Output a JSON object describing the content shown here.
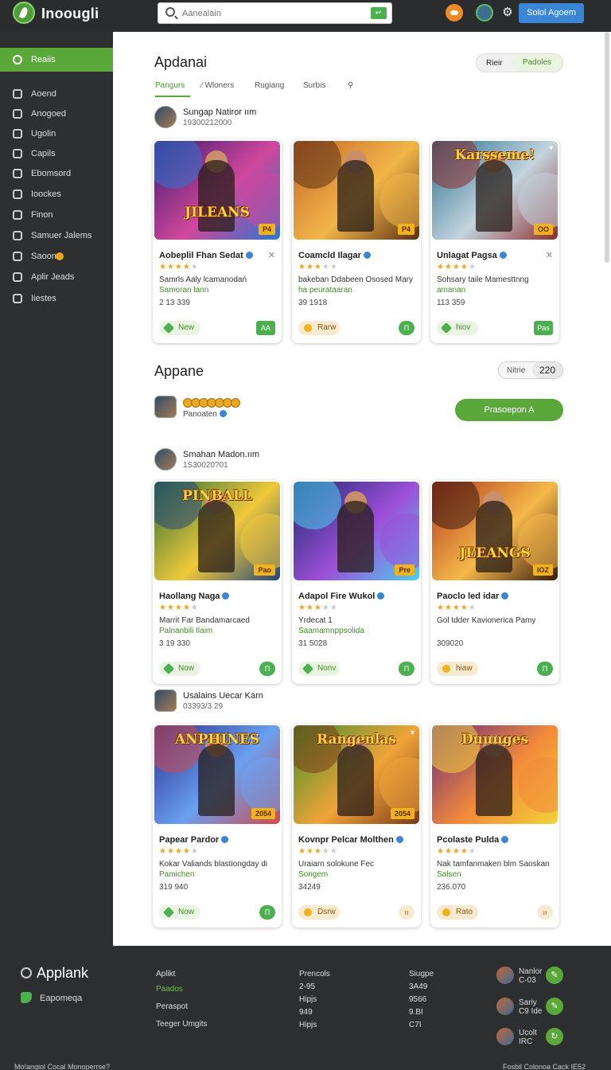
{
  "header": {
    "brand": "Inoougli",
    "search_placeholder": "Aanealain",
    "search_button": "↵",
    "signin_label": "Solol Agoem"
  },
  "sidebar": {
    "items": [
      {
        "label": "Reaiis",
        "icon": "user-icon",
        "active": true
      },
      {
        "label": "Aoend",
        "icon": "phone-icon"
      },
      {
        "label": "Anogoed",
        "icon": "grid-icon"
      },
      {
        "label": "Ugolin",
        "icon": "person-icon"
      },
      {
        "label": "Capils",
        "icon": "lock-icon"
      },
      {
        "label": "Ebomsord",
        "icon": "board-icon"
      },
      {
        "label": "Ioockes",
        "icon": "blocks-icon"
      },
      {
        "label": "Finon",
        "icon": "chart-icon"
      },
      {
        "label": "Samuer Jalems",
        "icon": "list-icon"
      },
      {
        "label": "Saoon",
        "icon": "people-icon"
      },
      {
        "label": "Aplir Jeads",
        "icon": "info-icon"
      },
      {
        "label": "Iiestes",
        "icon": "gear-icon"
      }
    ]
  },
  "section1": {
    "title": "Apdanai",
    "toggle": {
      "left": "Rieir",
      "right": "Padoles"
    },
    "tabs": [
      "Pangurs",
      "⁄ Wloners",
      "Rugiang",
      "Surbis",
      "⚲"
    ]
  },
  "section2": {
    "title": "Appane",
    "counter_label": "Nitrie",
    "counter_value": "220",
    "user_line": "Panoaten",
    "button": "Prasoepon A"
  },
  "groups": [
    {
      "user": {
        "name": "Sungap Natiror ıım",
        "date": "19300212000"
      },
      "cards": [
        {
          "art_title": "JILEANS",
          "art_badge": "P4",
          "title": "Aobeplil Fhan Sedat",
          "rating": 4,
          "desc": "Samrls Aaly lcamanodań",
          "desc_green": "Samoran lann",
          "num": "2 13 339",
          "pill": "New",
          "pill_style": "green",
          "action": "AA",
          "closable": true
        },
        {
          "art_title": "",
          "art_badge": "P4",
          "title": "Coamcld Ilagar",
          "rating": 3,
          "desc": "bakeban Ddabeen Ososed Mary",
          "desc_green": "ha peurataaran",
          "num": "39 1918",
          "pill": "Rarw",
          "pill_style": "gold",
          "action": "Π",
          "closable": false
        },
        {
          "art_title": "Karsseme!",
          "art_badge": "OO",
          "title": "Unlagat Pagsa",
          "rating": 4,
          "desc": "Sohsary taile Mamesttnng",
          "desc_green": "amanan",
          "num": "113 359",
          "pill": "hiov",
          "pill_style": "green",
          "action": "Pas",
          "closable": true
        }
      ]
    },
    {
      "user": {
        "name": "Smahan Madon.ıım",
        "date": "1S30020?01"
      },
      "cards": [
        {
          "art_title": "PINBALL",
          "art_badge": "Pao",
          "title": "Haollang Naga",
          "rating": 4,
          "desc": "Marrit Far Bandamarcaed",
          "desc_green": "Palnanbili Ilaim",
          "num": "3 19 330",
          "pill": "Now",
          "pill_style": "green",
          "action": "Π",
          "closable": false
        },
        {
          "art_title": "",
          "art_badge": "Pre",
          "title": "Adapol Fire Wukol",
          "rating": 3,
          "desc": "Yrdecat 1",
          "desc_green": "Saamamnppsolida",
          "num": "31 5028",
          "pill": "Nonv",
          "pill_style": "green",
          "action": "Π",
          "closable": false
        },
        {
          "art_title": "JEEANGS",
          "art_badge": "IOZ",
          "title": "Paoclo led idar",
          "rating": 4,
          "desc": "Gol tdder Kavionericа Pamy",
          "desc_green": "",
          "num": "309020",
          "pill": "hiaw",
          "pill_style": "gold",
          "action": "Π",
          "closable": false
        }
      ]
    },
    {
      "user": {
        "name": "Usalains Uecar Karn",
        "date": "03393/3 29"
      },
      "cards": [
        {
          "art_title": "ANPHINES",
          "art_badge": "2054",
          "title": "Papear Pardor",
          "rating": 4,
          "desc": "Kokar Valiands blastiongday di",
          "desc_green": "Pamichen",
          "num": "319 940",
          "pill": "Now",
          "pill_style": "green",
          "action": "Π",
          "closable": false
        },
        {
          "art_title": "Rangenlas",
          "art_badge": "2054",
          "title": "Kovnpr Pelcar Molthen",
          "rating": 3,
          "desc": "Uraiarn solokune Fec",
          "desc_green": "Songem",
          "num": "34249",
          "pill": "Dsrw",
          "pill_style": "gold",
          "action": "ıı",
          "closable": false
        },
        {
          "art_title": "Duuuges",
          "art_badge": "",
          "title": "Pcolaste Pulda",
          "rating": 4,
          "desc": "Nak tamfanmaken blm Saoskan",
          "desc_green": "Salsen",
          "num": "236.070",
          "pill": "Rato",
          "pill_style": "gold",
          "action": "ıı",
          "closable": false
        }
      ]
    }
  ],
  "footer": {
    "brand": "Applank",
    "phone_label": "Eapomeqa",
    "col1": {
      "title": "Aplikt",
      "lines": [
        "Paados",
        "Peraspot",
        "Teeger Umgits"
      ]
    },
    "col2": {
      "title": "Prencols",
      "lines": [
        "2-95",
        "Hipjs",
        "949",
        "Hipjs"
      ]
    },
    "col3": {
      "title": "Siugpe",
      "lines": [
        "3A49",
        "9566",
        "9.BI",
        "C7I"
      ]
    },
    "people": [
      {
        "name": "Nanlor",
        "sub": "C-03"
      },
      {
        "name": "Sariy",
        "sub": "C9 Ide"
      },
      {
        "name": "Ucolt",
        "sub": "IRC"
      }
    ],
    "bottom_left": "Mo!angiol Cocal Monoperrse?",
    "bottom_right": "Fosbil Colonoa Cack IE52"
  },
  "colors": {
    "accent": "#5aa83a",
    "sidebar_bg": "#2d2f31",
    "signin": "#3a86d6",
    "star": "#f2a41c"
  }
}
